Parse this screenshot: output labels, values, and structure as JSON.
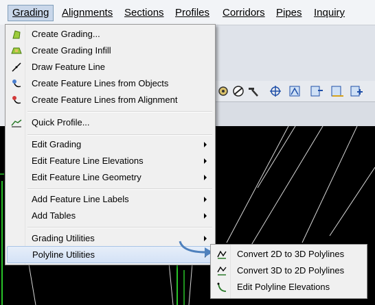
{
  "menubar": {
    "items": [
      {
        "label": "Grading",
        "active": true
      },
      {
        "label": "Alignments",
        "active": false
      },
      {
        "label": "Sections",
        "active": false
      },
      {
        "label": "Profiles",
        "active": false
      },
      {
        "label": "Corridors",
        "active": false
      },
      {
        "label": "Pipes",
        "active": false
      },
      {
        "label": "Inquiry",
        "active": false
      }
    ]
  },
  "grading_menu": {
    "items": [
      {
        "label": "Create Grading...",
        "icon": "create-grading-icon",
        "submenu": false
      },
      {
        "label": "Create Grading Infill",
        "icon": "grading-infill-icon",
        "submenu": false
      },
      {
        "label": "Draw Feature Line",
        "icon": "draw-feature-line-icon",
        "submenu": false
      },
      {
        "label": "Create Feature Lines from Objects",
        "icon": "feature-lines-objects-icon",
        "submenu": false
      },
      {
        "label": "Create Feature Lines from Alignment",
        "icon": "feature-lines-alignment-icon",
        "submenu": false
      },
      {
        "label": "Quick Profile...",
        "icon": "quick-profile-icon",
        "submenu": false
      },
      {
        "label": "Edit Grading",
        "icon": "",
        "submenu": true
      },
      {
        "label": "Edit Feature Line Elevations",
        "icon": "",
        "submenu": true
      },
      {
        "label": "Edit Feature Line Geometry",
        "icon": "",
        "submenu": true
      },
      {
        "label": "Add Feature Line Labels",
        "icon": "",
        "submenu": true
      },
      {
        "label": "Add Tables",
        "icon": "",
        "submenu": true
      },
      {
        "label": "Grading Utilities",
        "icon": "",
        "submenu": true
      },
      {
        "label": "Polyline Utilities",
        "icon": "",
        "submenu": true,
        "highlighted": true
      }
    ]
  },
  "polyline_submenu": {
    "items": [
      {
        "label": "Convert 2D to 3D Polylines",
        "icon": "convert-2d-3d-icon"
      },
      {
        "label": "Convert 3D to 2D Polylines",
        "icon": "convert-3d-2d-icon"
      },
      {
        "label": "Edit Polyline Elevations",
        "icon": "edit-polyline-elevations-icon"
      }
    ]
  },
  "colors": {
    "menu_bg": "#f0f0f0",
    "highlight": "#d4e2f6",
    "canvas": "#000000",
    "callout_arrow": "#4f81bd"
  }
}
